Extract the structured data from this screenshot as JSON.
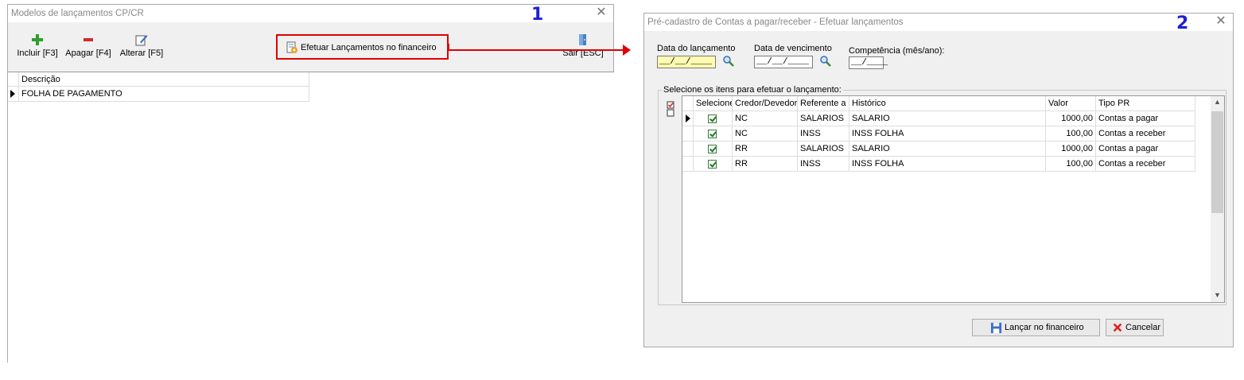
{
  "window1": {
    "title": "Modelos de lançamentos CP/CR",
    "marker": "1",
    "toolbar": {
      "incluir": "Incluir [F3]",
      "apagar": "Apagar [F4]",
      "alterar": "Alterar [F5]",
      "efetuar": "Efetuar Lançamentos no financeiro",
      "sair": "Sair [ESC]"
    },
    "grid": {
      "column": "Descrição",
      "rows": [
        "FOLHA DE PAGAMENTO"
      ]
    }
  },
  "window2": {
    "title": "Pré-cadastro de Contas a pagar/receber - Efetuar lançamentos",
    "marker": "2",
    "fields": {
      "data_lancamento_label": "Data do lançamento",
      "data_lancamento_value": "__/__/____",
      "data_vencimento_label": "Data de vencimento",
      "data_vencimento_value": "__/__/____",
      "competencia_label": "Competência (mês/ano):",
      "competencia_value": "__/____"
    },
    "group_title": "Selecione os itens para efetuar o lançamento:",
    "columns": [
      "Selecione",
      "Credor/Devedor",
      "Referente a",
      "Histórico",
      "Valor",
      "Tipo PR"
    ],
    "rows": [
      {
        "selected": true,
        "credor": "NC",
        "referente": "SALARIOS",
        "historico": "SALARIO",
        "valor": "1000,00",
        "tipo": "Contas a pagar"
      },
      {
        "selected": true,
        "credor": "NC",
        "referente": "INSS",
        "historico": "INSS FOLHA",
        "valor": "100,00",
        "tipo": "Contas a receber"
      },
      {
        "selected": true,
        "credor": "RR",
        "referente": "SALARIOS",
        "historico": "SALARIO",
        "valor": "1000,00",
        "tipo": "Contas a pagar"
      },
      {
        "selected": true,
        "credor": "RR",
        "referente": "INSS",
        "historico": "INSS FOLHA",
        "valor": "100,00",
        "tipo": "Contas a receber"
      }
    ],
    "buttons": {
      "lancar": "Lançar no financeiro",
      "cancelar": "Cancelar"
    }
  },
  "colors": {
    "highlight": "#e00000",
    "marker": "#1f1fd6",
    "date_highlight": "#fffbb0"
  }
}
